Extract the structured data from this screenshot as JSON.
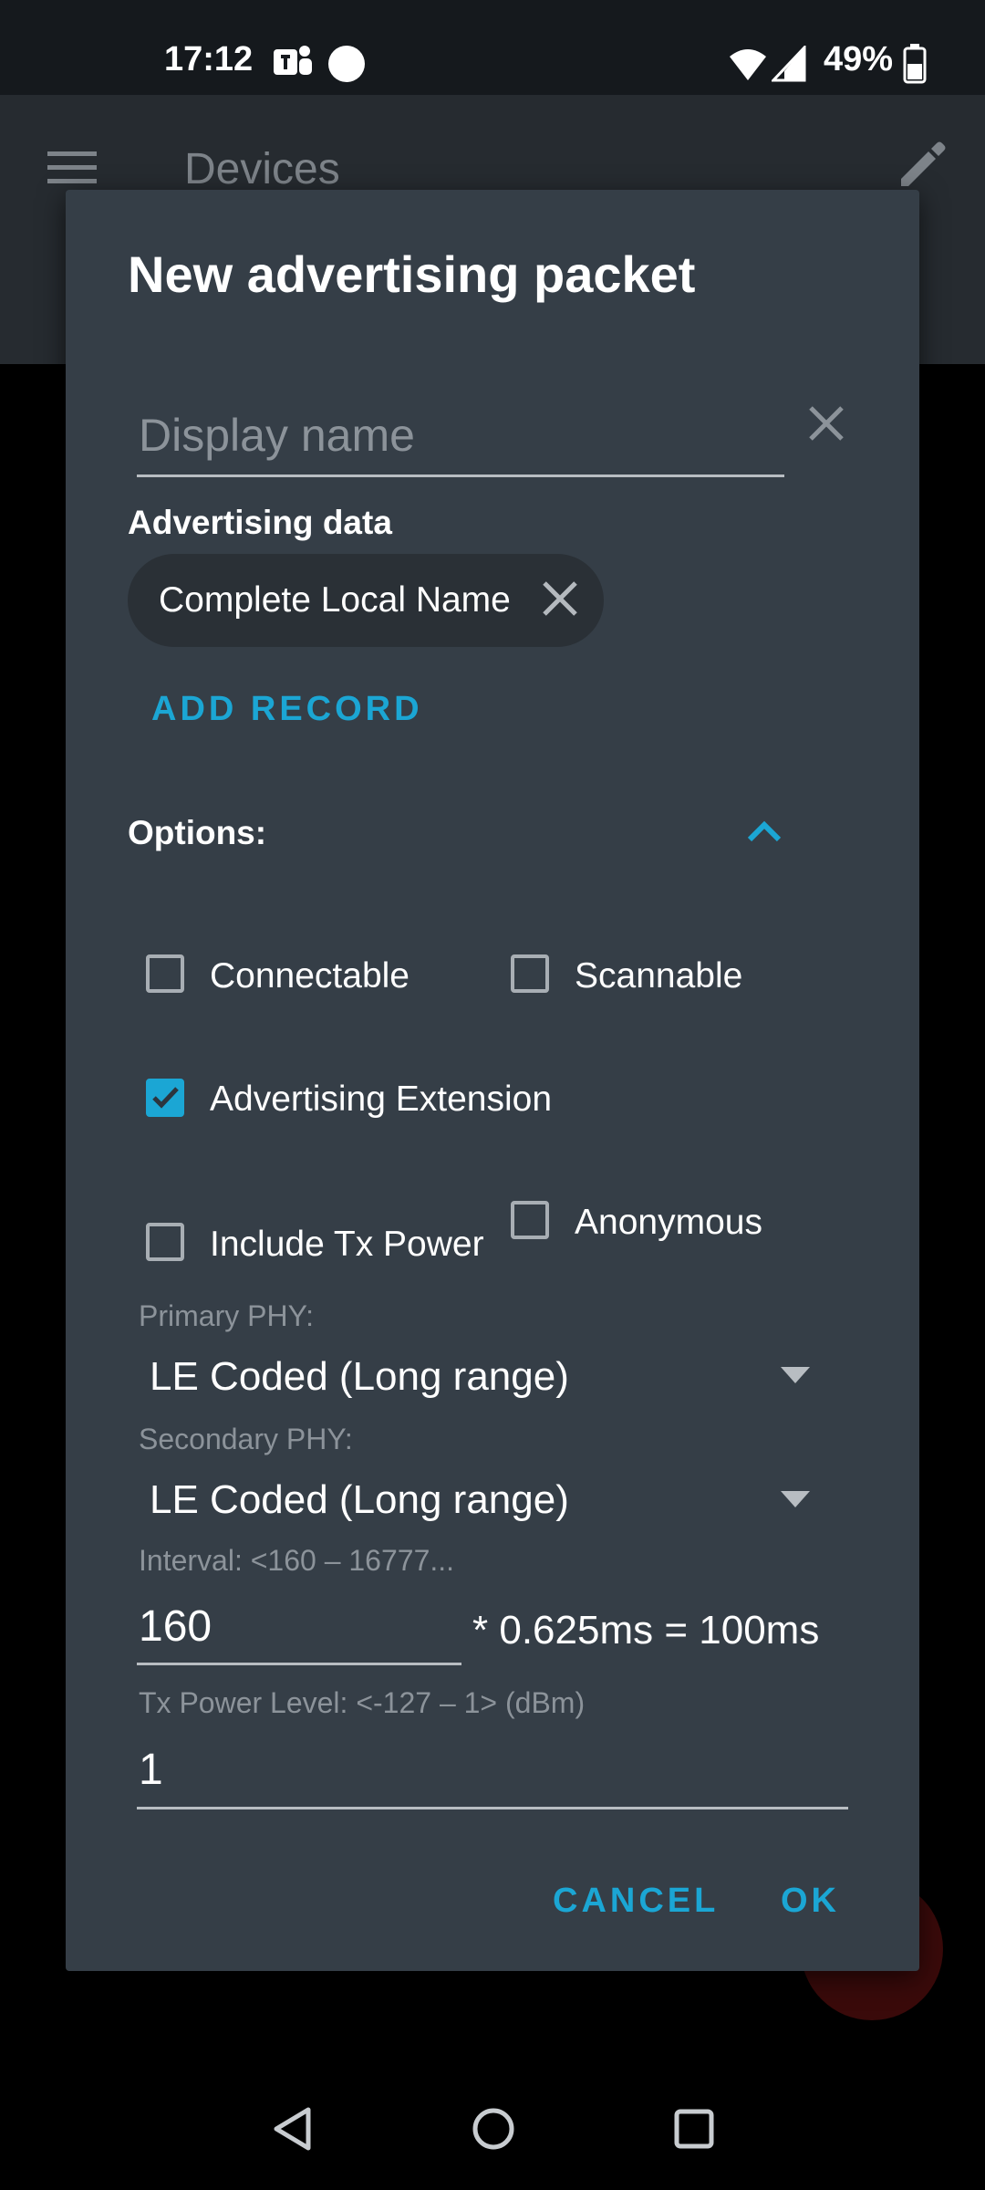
{
  "status_bar": {
    "time": "17:12",
    "battery_percent": "49%",
    "icons": [
      "teams-icon",
      "circle-notification-icon",
      "wifi-icon",
      "cell-signal-icon",
      "battery-icon"
    ]
  },
  "app_bar": {
    "title": "Devices",
    "icons": [
      "hamburger-menu-icon",
      "edit-pencil-icon"
    ]
  },
  "dialog": {
    "title": "New advertising packet",
    "display_name_placeholder": "Display name",
    "advertising_data_label": "Advertising data",
    "records": [
      {
        "label": "Complete Local Name"
      }
    ],
    "add_record_label": "ADD RECORD",
    "options_label": "Options:",
    "options_expanded": true,
    "checkboxes": {
      "connectable": {
        "label": "Connectable",
        "checked": false
      },
      "scannable": {
        "label": "Scannable",
        "checked": false
      },
      "advertising_extension": {
        "label": "Advertising Extension",
        "checked": true
      },
      "include_tx_power": {
        "label": "Include Tx Power",
        "checked": false
      },
      "anonymous": {
        "label": "Anonymous",
        "checked": false
      }
    },
    "primary_phy": {
      "label": "Primary PHY:",
      "value": "LE Coded (Long range)"
    },
    "secondary_phy": {
      "label": "Secondary PHY:",
      "value": "LE Coded (Long range)"
    },
    "interval": {
      "label": "Interval: <160 – 16777...",
      "value": "160",
      "calculation": "* 0.625ms = 100ms"
    },
    "tx_power": {
      "label": "Tx Power Level: <-127 – 1> (dBm)",
      "value": "1"
    },
    "buttons": {
      "cancel": "CANCEL",
      "ok": "OK"
    }
  },
  "colors": {
    "accent": "#1ba6d4",
    "dialog_bg": "#353e47",
    "chip_bg": "#2a3036"
  }
}
